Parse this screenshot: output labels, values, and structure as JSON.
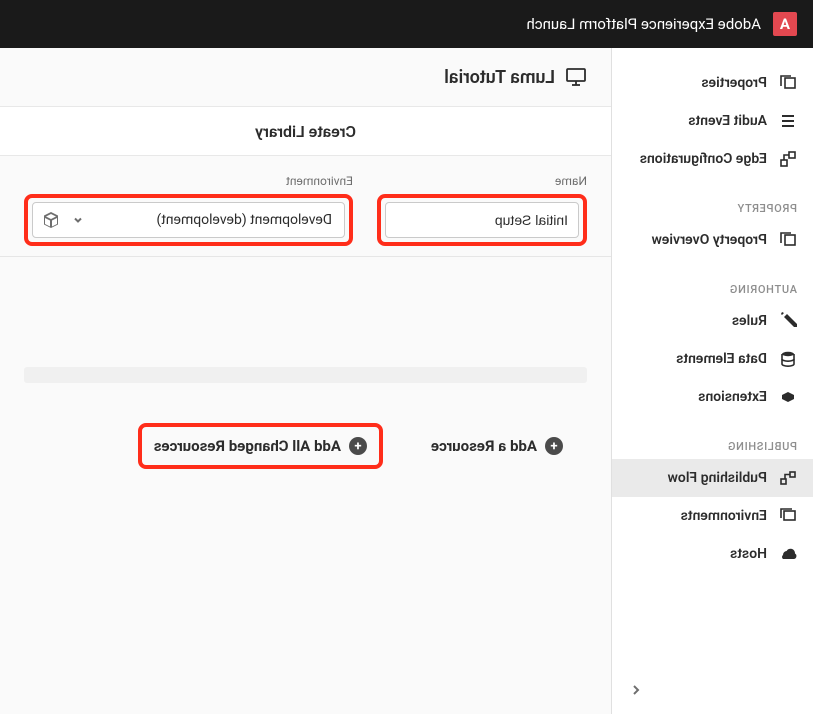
{
  "header": {
    "logo_letter": "A",
    "app_title": "Adobe Experience Platform Launch"
  },
  "sidebar": {
    "top_items": [
      {
        "label": "Properties"
      },
      {
        "label": "Audit Events"
      },
      {
        "label": "Edge Configurations"
      }
    ],
    "property_section_label": "PROPERTY",
    "property_item": {
      "label": "Property Overview"
    },
    "authoring_section_label": "AUTHORING",
    "authoring_items": [
      {
        "label": "Rules"
      },
      {
        "label": "Data Elements"
      },
      {
        "label": "Extensions"
      }
    ],
    "publishing_section_label": "PUBLISHING",
    "publishing_items": [
      {
        "label": "Publishing Flow"
      },
      {
        "label": "Environments"
      },
      {
        "label": "Hosts"
      }
    ]
  },
  "main": {
    "property_name": "Luma Tutorial",
    "page_title": "Create Library",
    "form": {
      "name_label": "Name",
      "name_value": "Initial Setup",
      "env_label": "Environment",
      "env_value": "Development (development)"
    },
    "add_resource_label": "Add a Resource",
    "add_all_label": "Add All Changed Resources"
  }
}
